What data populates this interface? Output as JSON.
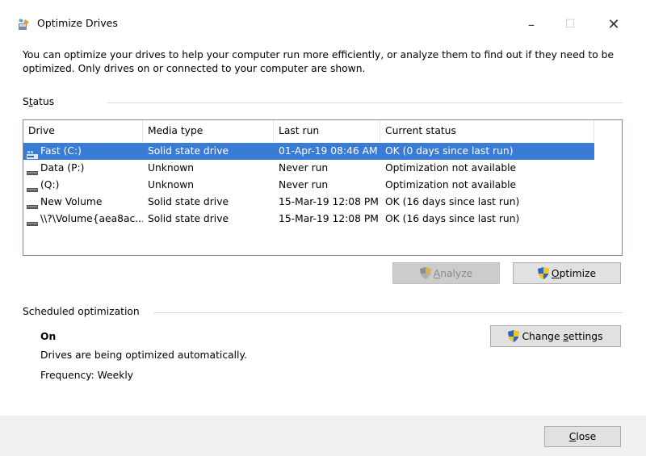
{
  "window": {
    "title": "Optimize Drives",
    "min_glyph": "–",
    "max_glyph": "☐",
    "close_glyph": "✕"
  },
  "intro": "You can optimize your drives to help your computer run more efficiently, or analyze them to find out if they need to be optimized. Only drives on or connected to your computer are shown.",
  "status": {
    "label_pre": "S",
    "label_access": "t",
    "label_post": "atus",
    "columns": [
      "Drive",
      "Media type",
      "Last run",
      "Current status"
    ],
    "rows": [
      {
        "drive": "Fast (C:)",
        "media": "Solid state drive",
        "last_run": "01-Apr-19 08:46 AM",
        "status": "OK (0 days since last run)",
        "icon": "windows-drive-icon",
        "selected": true
      },
      {
        "drive": "Data (P:)",
        "media": "Unknown",
        "last_run": "Never run",
        "status": "Optimization not available",
        "icon": "hard-drive-icon",
        "selected": false
      },
      {
        "drive": "(Q:)",
        "media": "Unknown",
        "last_run": "Never run",
        "status": "Optimization not available",
        "icon": "hard-drive-icon",
        "selected": false
      },
      {
        "drive": "New Volume",
        "media": "Solid state drive",
        "last_run": "15-Mar-19 12:08 PM",
        "status": "OK (16 days since last run)",
        "icon": "hard-drive-icon",
        "selected": false
      },
      {
        "drive": "\\\\?\\Volume{aea8ac...",
        "media": "Solid state drive",
        "last_run": "15-Mar-19 12:08 PM",
        "status": "OK (16 days since last run)",
        "icon": "hard-drive-icon",
        "selected": false
      }
    ]
  },
  "buttons": {
    "analyze_access": "A",
    "analyze_rest": "nalyze",
    "optimize_access": "O",
    "optimize_rest": "ptimize",
    "change_pre": "Change ",
    "change_access": "s",
    "change_post": "ettings",
    "close_access": "C",
    "close_rest": "lose"
  },
  "scheduled": {
    "label": "Scheduled optimization",
    "state": "On",
    "description": "Drives are being optimized automatically.",
    "frequency": "Frequency: Weekly"
  },
  "colors": {
    "selection": "#3a7bd5",
    "shield_blue": "#2a62c9",
    "shield_yellow": "#f5c518"
  }
}
